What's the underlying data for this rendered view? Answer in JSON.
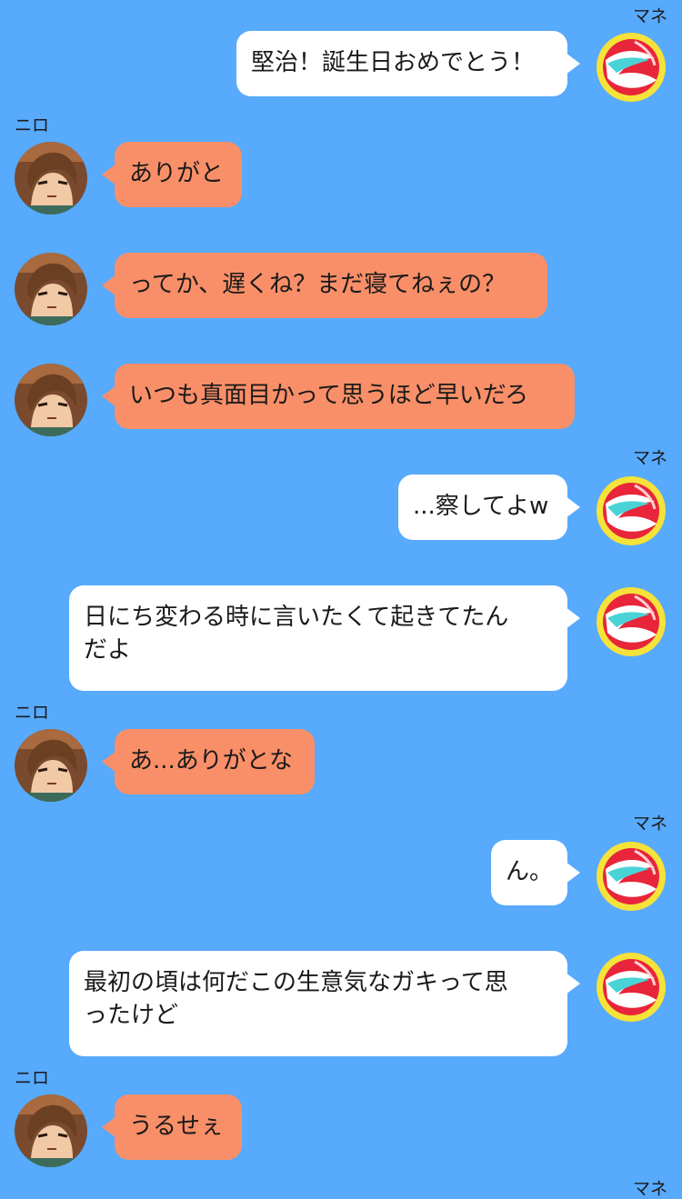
{
  "colors": {
    "background": "#57aafc",
    "self_bubble": "#ffffff",
    "other_bubble": "#f98f68"
  },
  "chat": {
    "self_name": "マネ",
    "other_name": "ニロ",
    "messages": [
      {
        "sender": "self",
        "text": "堅治！誕生日おめでとう！"
      },
      {
        "sender": "other",
        "text": "ありがと"
      },
      {
        "sender": "other",
        "text": "ってか、遅くね？まだ寝てねぇの？"
      },
      {
        "sender": "other",
        "text": "いつも真面目かって思うほど早いだろ"
      },
      {
        "sender": "self",
        "text": "...察してよw"
      },
      {
        "sender": "self",
        "text": "日にち変わる時に言いたくて起きてたん\nだよ"
      },
      {
        "sender": "other",
        "text": "あ...ありがとな"
      },
      {
        "sender": "self",
        "text": "ん。"
      },
      {
        "sender": "self",
        "text": "最初の頃は何だこの生意気なガキって思\nったけど"
      },
      {
        "sender": "other",
        "text": "うるせぇ"
      }
    ]
  }
}
